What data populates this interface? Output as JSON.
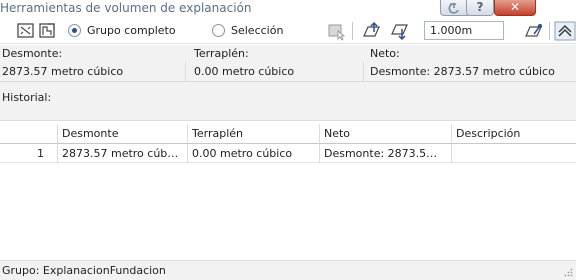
{
  "window": {
    "title": "Herramientas de volumen de explanación",
    "help_glyph": "?",
    "close_glyph": "✕"
  },
  "toolbar": {
    "radio_full_group": {
      "label": "Grupo completo",
      "checked": true
    },
    "radio_selection": {
      "label": "Selección",
      "checked": false
    },
    "zoom_value": "1.000m"
  },
  "summary": {
    "cut_header": "Desmonte:",
    "fill_header": "Terraplén:",
    "net_header": "Neto:",
    "cut_value": "2873.57 metro cúbico",
    "fill_value": "0.00 metro cúbico",
    "net_value": "Desmonte: 2873.57 metro cúbico",
    "history_label": "Historial:"
  },
  "table": {
    "columns": [
      "",
      "Desmonte",
      "Terraplén",
      "Neto",
      "Descripción"
    ],
    "rows": [
      {
        "index": "1",
        "cut": "2873.57 metro cúb…",
        "fill": "0.00 metro cúbico",
        "net": "Desmonte: 2873.5…",
        "description": ""
      }
    ]
  },
  "status_bar": {
    "text": "Grupo: ExplanacionFundacion"
  },
  "colors": {
    "accent": "#2a4f8f",
    "close": "#c6402b",
    "panel": "#f2f2f2",
    "title_text": "#5a6e86"
  }
}
